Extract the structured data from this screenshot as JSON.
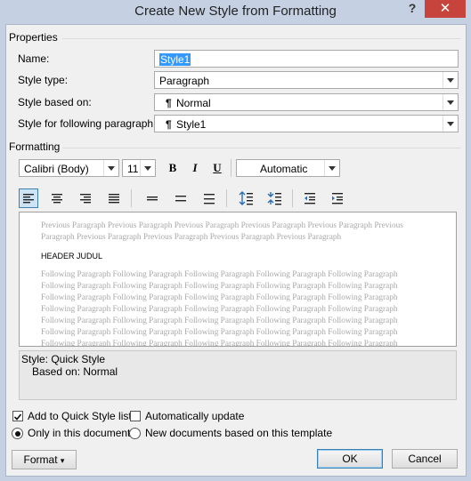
{
  "window": {
    "title": "Create New Style from Formatting",
    "help_label": "?",
    "close_label": "✕"
  },
  "properties": {
    "section_label": "Properties",
    "name_label": "Name:",
    "name_value": "Style1",
    "style_type_label": "Style type:",
    "style_type_value": "Paragraph",
    "based_on_label": "Style based on:",
    "based_on_value": "Normal",
    "following_label": "Style for following paragraph:",
    "following_value": "Style1",
    "paragraph_glyph": "¶"
  },
  "formatting": {
    "section_label": "Formatting",
    "font": "Calibri (Body)",
    "size": "11",
    "bold": "B",
    "italic": "I",
    "underline": "U",
    "color": "Automatic"
  },
  "preview": {
    "previous_lines": [
      "Previous Paragraph Previous Paragraph Previous Paragraph Previous Paragraph Previous Paragraph Previous",
      "Paragraph Previous Paragraph Previous Paragraph Previous Paragraph Previous Paragraph"
    ],
    "sample": "HEADER JUDUL",
    "following_lines": [
      "Following Paragraph Following Paragraph Following Paragraph Following Paragraph Following Paragraph",
      "Following Paragraph Following Paragraph Following Paragraph Following Paragraph Following Paragraph",
      "Following Paragraph Following Paragraph Following Paragraph Following Paragraph Following Paragraph",
      "Following Paragraph Following Paragraph Following Paragraph Following Paragraph Following Paragraph",
      "Following Paragraph Following Paragraph Following Paragraph Following Paragraph Following Paragraph",
      "Following Paragraph Following Paragraph Following Paragraph Following Paragraph Following Paragraph",
      "Following Paragraph Following Paragraph Following Paragraph Following Paragraph Following Paragraph"
    ]
  },
  "description": {
    "line1": "Style: Quick Style",
    "line2": "Based on: Normal"
  },
  "options": {
    "add_quick_style": "Add to Quick Style list",
    "add_quick_style_checked": true,
    "auto_update": "Automatically update",
    "auto_update_checked": false,
    "only_this_doc": "Only in this document",
    "only_this_doc_selected": true,
    "new_docs": "New documents based on this template",
    "new_docs_selected": false
  },
  "buttons": {
    "format": "Format",
    "format_arrow": "▾",
    "ok": "OK",
    "cancel": "Cancel"
  }
}
